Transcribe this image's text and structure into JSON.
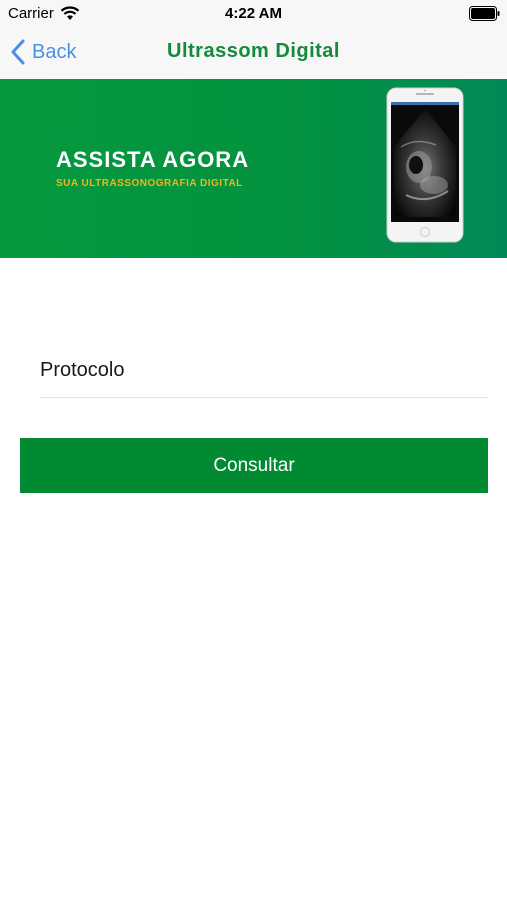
{
  "status_bar": {
    "carrier": "Carrier",
    "time": "4:22 AM",
    "icons": [
      "wifi-icon",
      "battery-icon"
    ]
  },
  "nav": {
    "back_label": "Back",
    "title": "Ultrassom Digital",
    "title_color": "#158a3c",
    "back_color": "#4a90e2"
  },
  "banner": {
    "title": "ASSISTA AGORA",
    "subtitle": "SUA ULTRASSONOGRAFIA DIGITAL",
    "background_color": "#069a3d",
    "subtitle_color": "#f2b31f"
  },
  "form": {
    "protocol_placeholder": "Protocolo",
    "protocol_value": "",
    "submit_label": "Consultar",
    "submit_color": "#028a32"
  }
}
